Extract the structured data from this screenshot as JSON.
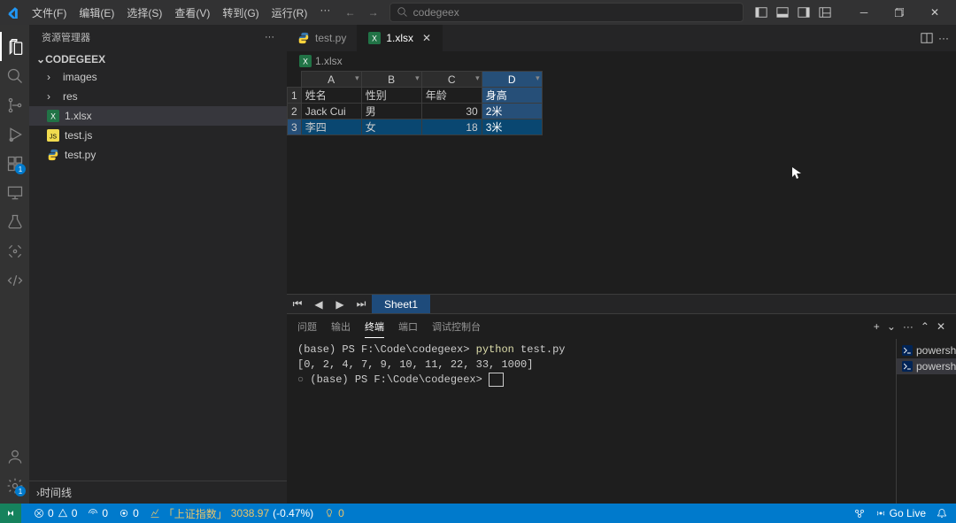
{
  "menu": {
    "file": "文件(F)",
    "edit": "编辑(E)",
    "select": "选择(S)",
    "view": "查看(V)",
    "go": "转到(G)",
    "run": "运行(R)"
  },
  "search": {
    "placeholder": "codegeex"
  },
  "sidebar": {
    "title": "资源管理器",
    "root": "CODEGEEX",
    "folders": [
      "images",
      "res"
    ],
    "files": [
      {
        "name": "1.xlsx",
        "icon": "excel"
      },
      {
        "name": "test.js",
        "icon": "js"
      },
      {
        "name": "test.py",
        "icon": "py"
      }
    ],
    "timeline": "时间线"
  },
  "tabs": [
    {
      "label": "test.py",
      "icon": "py",
      "active": false
    },
    {
      "label": "1.xlsx",
      "icon": "excel",
      "active": true
    }
  ],
  "breadcrumb": {
    "file": "1.xlsx",
    "icon": "excel"
  },
  "sheet": {
    "columns": [
      "A",
      "B",
      "C",
      "D"
    ],
    "headers": [
      "姓名",
      "性别",
      "年龄",
      "身高"
    ],
    "rows": [
      {
        "name": "Jack Cui",
        "gender": "男",
        "age": "30",
        "height": "2米"
      },
      {
        "name": "李四",
        "gender": "女",
        "age": "18",
        "height": "3米"
      }
    ],
    "row_numbers": [
      "1",
      "2",
      "3"
    ],
    "sheet_name": "Sheet1"
  },
  "panel": {
    "tabs": {
      "problems": "问题",
      "output": "输出",
      "terminal": "终端",
      "ports": "端口",
      "debug": "调试控制台"
    }
  },
  "terminal": {
    "line1_prefix": "(base) PS F:\\Code\\codegeex> ",
    "line1_cmd": "python",
    "line1_arg": " test.py",
    "line2": "[0, 2, 4, 7, 9, 10, 11, 22, 33, 1000]",
    "line3": "(base) PS F:\\Code\\codegeex> ",
    "shells": [
      "powershell",
      "powershell"
    ]
  },
  "statusbar": {
    "errors": "0",
    "warnings": "0",
    "ports": "0",
    "radio": "0",
    "stock_label": "「上证指数」",
    "stock_value": "3038.97",
    "stock_change": "(-0.47%)",
    "bulb": "0",
    "golive": "Go Live"
  },
  "chart_data": {
    "type": "table",
    "columns": [
      "姓名",
      "性别",
      "年龄",
      "身高"
    ],
    "rows": [
      [
        "Jack Cui",
        "男",
        30,
        "2米"
      ],
      [
        "李四",
        "女",
        18,
        "3米"
      ]
    ]
  }
}
